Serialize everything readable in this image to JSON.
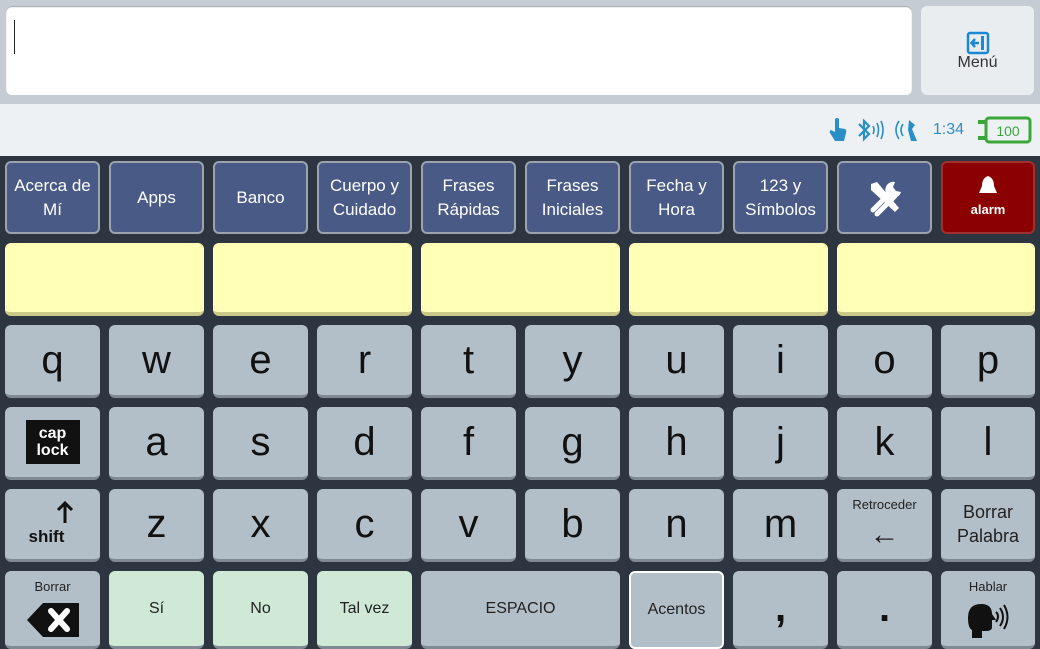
{
  "menu": {
    "label": "Menú"
  },
  "status": {
    "time": "1:34",
    "battery": "100"
  },
  "categories": [
    {
      "line1": "Acerca de",
      "line2": "Mí"
    },
    {
      "line1": "Apps",
      "line2": ""
    },
    {
      "line1": "Banco",
      "line2": ""
    },
    {
      "line1": "Cuerpo y",
      "line2": "Cuidado"
    },
    {
      "line1": "Frases",
      "line2": "Rápidas"
    },
    {
      "line1": "Frases",
      "line2": "Iniciales"
    },
    {
      "line1": "Fecha y",
      "line2": "Hora"
    },
    {
      "line1": "123 y",
      "line2": "Símbolos"
    }
  ],
  "alarm": {
    "label": "alarm"
  },
  "predictions": [
    "",
    "",
    "",
    "",
    ""
  ],
  "row1": [
    "q",
    "w",
    "e",
    "r",
    "t",
    "y",
    "u",
    "i",
    "o",
    "p"
  ],
  "row2": [
    "a",
    "s",
    "d",
    "f",
    "g",
    "h",
    "j",
    "k",
    "l"
  ],
  "caplock": {
    "line1": "cap",
    "line2": "lock"
  },
  "shift": {
    "label": "shift"
  },
  "row3": [
    "z",
    "x",
    "c",
    "v",
    "b",
    "n",
    "m"
  ],
  "retroceder": {
    "label": "Retroceder",
    "arrow": "←"
  },
  "borrar_palabra": {
    "line1": "Borrar",
    "line2": "Palabra"
  },
  "borrar": {
    "label": "Borrar"
  },
  "si": "Sí",
  "no": "No",
  "talvez": "Tal vez",
  "espacio": "ESPACIO",
  "acentos": "Acentos",
  "comma": ",",
  "period": ".",
  "hablar": {
    "label": "Hablar"
  },
  "colors": {
    "category": "#4a5a86",
    "alarm": "#8b0000",
    "prediction": "#ffffb8",
    "key": "#b2bec8",
    "green_key": "#cfe9d6",
    "status_blue": "#2a8fc6",
    "battery_green": "#3aa63a"
  }
}
